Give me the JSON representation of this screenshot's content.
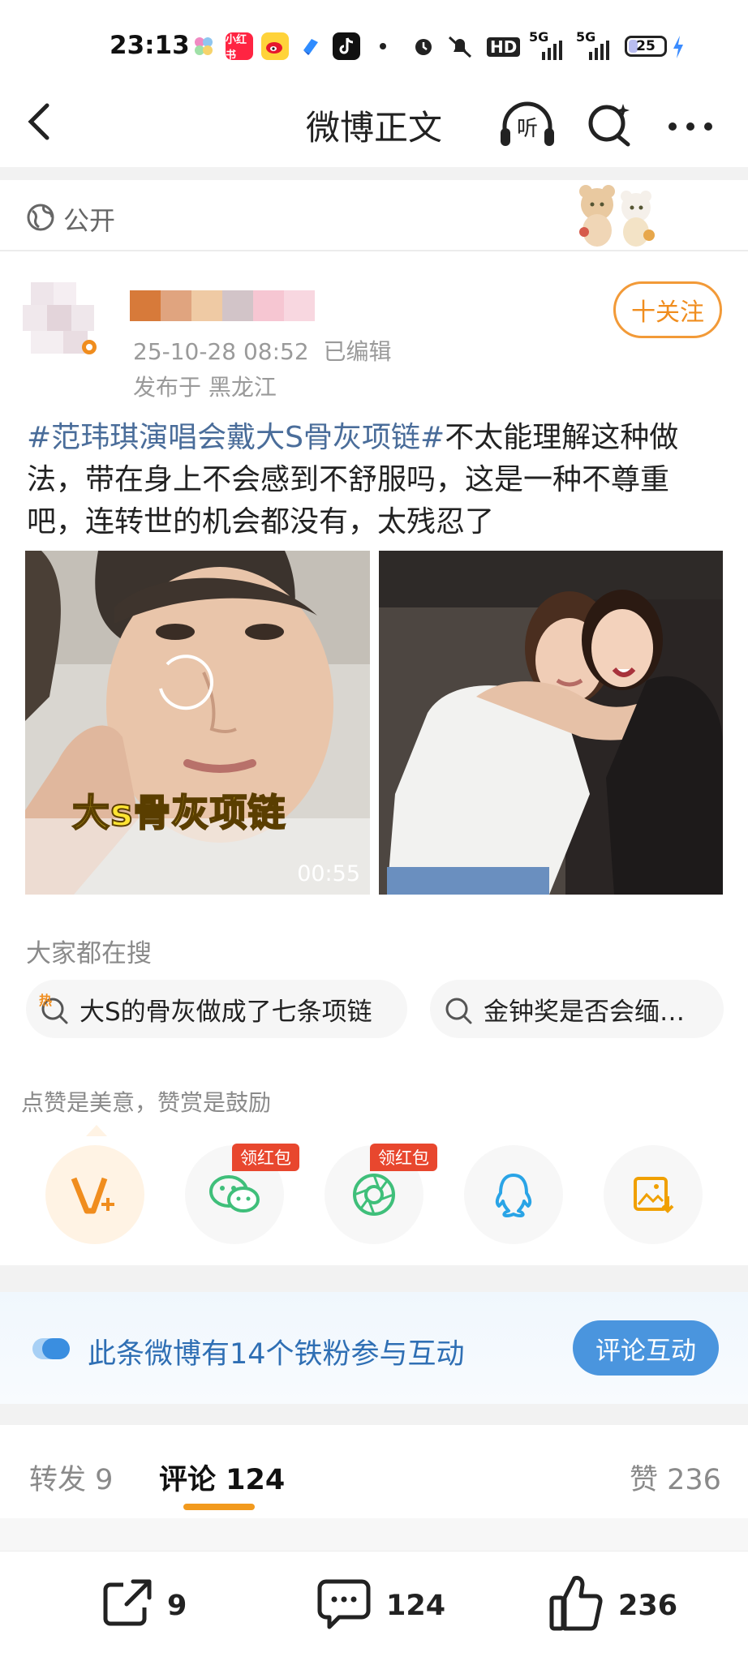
{
  "status_bar": {
    "time": "23:13",
    "app_badge_text": "小红书",
    "indicators": [
      "HD",
      "5G",
      "5G"
    ],
    "battery": "25",
    "battery_level": 0.25
  },
  "nav": {
    "back_icon": "chevron-left-icon",
    "title": "微博正文",
    "listen_label": "听",
    "search_icon": "search-spark-icon",
    "more_icon": "more-dots-icon"
  },
  "visibility": {
    "label": "公开",
    "icon": "globe-icon"
  },
  "post": {
    "timestamp": "25-10-28 08:52",
    "edited": "已编辑",
    "location": "发布于 黑龙江",
    "follow_label": "十关注",
    "hashtag": "#范玮琪演唱会戴大S骨灰项链#",
    "body": "不太能理解这种做法，带在身上不会感到不舒服吗，这是一种不尊重吧，连转世的机会都没有，太残忍了",
    "video_caption": "大s骨灰项链",
    "video_duration": "00:55",
    "username_colors": [
      "#d77a3a",
      "#e0a47f",
      "#efcaa4",
      "#d2c4c8",
      "#f6c6d2",
      "#f8d7e0"
    ]
  },
  "search": {
    "heading": "大家都在搜",
    "pills": [
      {
        "text": "大S的骨灰做成了七条项链",
        "badge": "热"
      },
      {
        "text": "金钟奖是否会缅…",
        "badge": ""
      }
    ]
  },
  "reward": {
    "heading": "点赞是美意，赞赏是鼓励",
    "items": [
      {
        "icon": "vplus-icon",
        "badge": ""
      },
      {
        "icon": "wechat-icon",
        "badge": "领红包"
      },
      {
        "icon": "moments-icon",
        "badge": "领红包"
      },
      {
        "icon": "qq-icon",
        "badge": ""
      },
      {
        "icon": "save-image-icon",
        "badge": ""
      }
    ]
  },
  "fan_banner": {
    "text": "此条微博有14个铁粉参与互动",
    "button": "评论互动"
  },
  "tabs": {
    "repost": "转发 9",
    "comments": "评论 124",
    "likes": "赞 236"
  },
  "bottom_bar": {
    "repost_count": "9",
    "comment_count": "124",
    "like_count": "236"
  },
  "colors": {
    "accent_orange": "#f29a38",
    "link_blue": "#4a6d9a",
    "banner_blue": "#4a95de"
  }
}
